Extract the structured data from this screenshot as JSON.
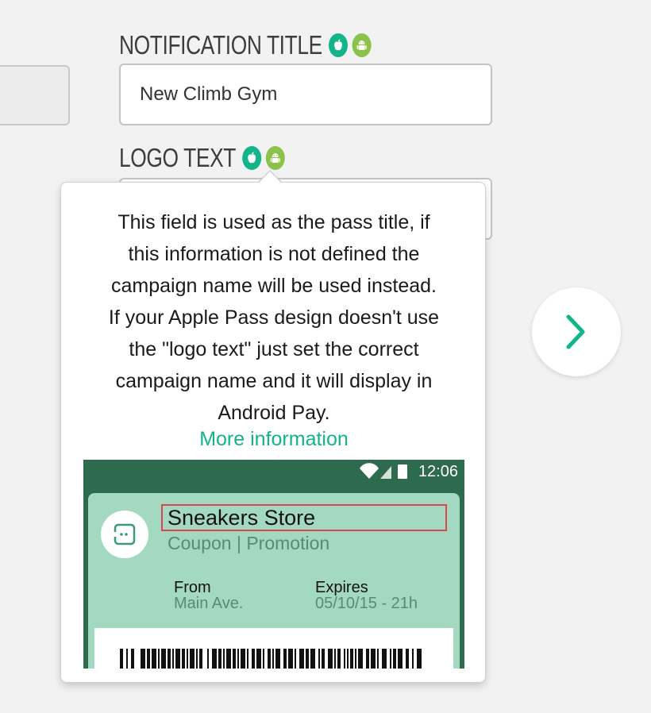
{
  "form": {
    "notification_title": {
      "label": "NOTIFICATION TITLE",
      "value": "New Climb Gym",
      "platform_icons": [
        "apple-icon",
        "android-icon"
      ]
    },
    "logo_text": {
      "label": "LOGO TEXT",
      "value": "",
      "platform_icons": [
        "apple-icon",
        "android-icon"
      ]
    }
  },
  "navigation": {
    "next_icon": "chevron-right-icon"
  },
  "tooltip": {
    "lines": [
      "This field is used as the pass title, if",
      "this information is not defined the",
      "campaign name will be used instead.",
      "If your Apple Pass design doesn't use",
      "the \"logo text\" just set the correct",
      "campaign name and it will display in",
      "Android Pay."
    ],
    "link_text": "More information",
    "preview": {
      "status_time": "12:06",
      "pass_title": "Sneakers Store",
      "pass_subtitle": "Coupon | Promotion",
      "fields": [
        {
          "label": "From",
          "value": "Main Ave."
        },
        {
          "label": "Expires",
          "value": "05/10/15 - 21h"
        }
      ]
    }
  },
  "colors": {
    "accent": "#12b48a",
    "android": "#8bc34a",
    "preview_header": "#2e6a4d",
    "preview_card": "#a3d9c0",
    "highlight": "#e0454b"
  }
}
